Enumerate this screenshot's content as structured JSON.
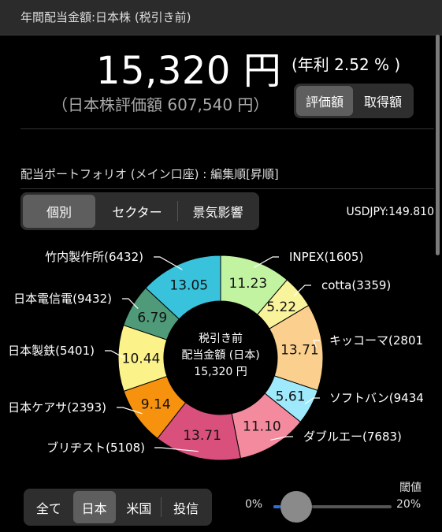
{
  "header": {
    "title": "年間配当金額:日本株 (税引き前)"
  },
  "summary": {
    "amount": "15,320 円",
    "yield": "(年利 2.52 % )",
    "valuation": "（日本株評価額 607,540 円）"
  },
  "price_toggle": {
    "options": [
      "評価額",
      "取得額"
    ],
    "selected": "評価額"
  },
  "portfolio": {
    "title": "配当ポートフォリオ (メイン口座) : 編集順[昇順]",
    "view_tabs": [
      "個別",
      "セクター",
      "景気影響"
    ],
    "view_selected": "個別",
    "fx_rate": "USDJPY:149.810"
  },
  "donut": {
    "center_line1": "税引き前",
    "center_line2": "配当金額 (日本)",
    "center_line3": "15,320 円"
  },
  "chart_data": {
    "type": "pie",
    "slices": [
      {
        "label": "INPEX(1605)",
        "value": 11.23,
        "value_label": "11.23",
        "color": "#c2f3a1"
      },
      {
        "label": "cotta(3359)",
        "value": 5.22,
        "value_label": "5.22",
        "color": "#f9f49c"
      },
      {
        "label": "キッコーマ(2801",
        "value": 13.71,
        "value_label": "13.71",
        "color": "#fbd08f"
      },
      {
        "label": "ソフトバン(9434",
        "value": 5.61,
        "value_label": "5.61",
        "color": "#9ee9fb"
      },
      {
        "label": "ダブルエー(7683)",
        "value": 11.1,
        "value_label": "11.10",
        "color": "#f48a9d"
      },
      {
        "label": "ブリヂスト(5108)",
        "value": 13.71,
        "value_label": "13.71",
        "color": "#d9507d"
      },
      {
        "label": "日本ケアサ(2393)",
        "value": 9.14,
        "value_label": "9.14",
        "color": "#f6920d"
      },
      {
        "label": "日本製鉄(5401)",
        "value": 10.44,
        "value_label": "10.44",
        "color": "#fbf28a"
      },
      {
        "label": "日本電信電(9432)",
        "value": 6.79,
        "value_label": "6.79",
        "color": "#4f9a79"
      },
      {
        "label": "竹内製作所(6432)",
        "value": 13.05,
        "value_label": "13.05",
        "color": "#39c2db"
      }
    ]
  },
  "market_tabs": {
    "options": [
      "全て",
      "日本",
      "米国",
      "投信"
    ],
    "selected": "日本"
  },
  "threshold": {
    "label": "閾値",
    "min_label": "0%",
    "max_label": "20%",
    "value_percent": 2
  }
}
